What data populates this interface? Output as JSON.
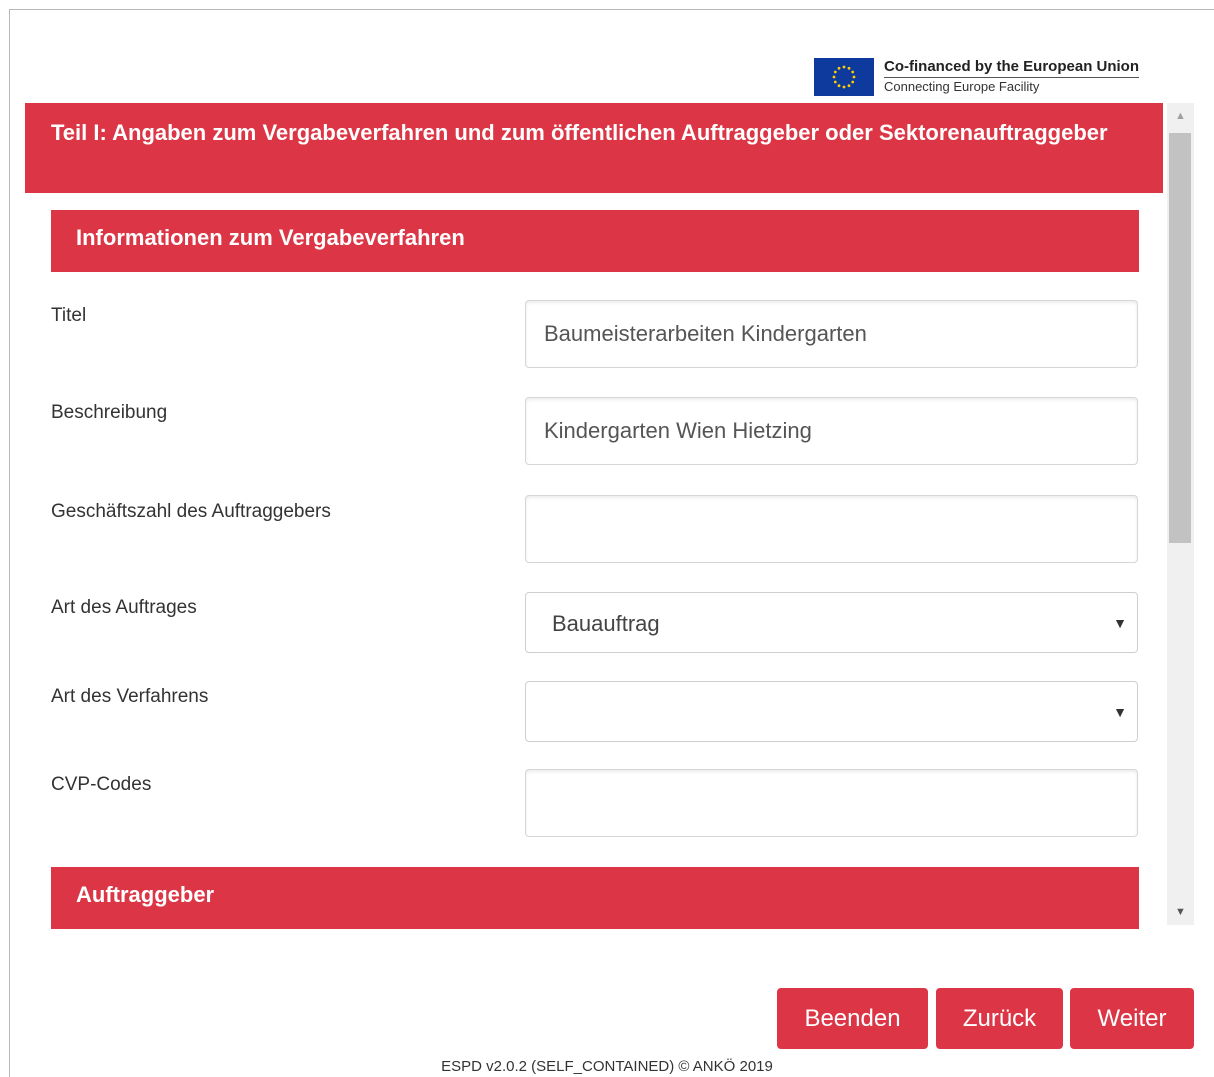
{
  "eu_badge": {
    "line1": "Co-financed by the European Union",
    "line2": "Connecting Europe Facility",
    "flag_color": "#0d3a9c",
    "star_color": "#ffcc00"
  },
  "main_header": "Teil I: Angaben zum Vergabeverfahren und zum öffentlichen Auftraggeber oder Sektorenauftraggeber",
  "sections": {
    "procedure": "Informationen zum Vergabeverfahren",
    "contracting": "Auftraggeber"
  },
  "fields": {
    "titel": {
      "label": "Titel",
      "value": "Baumeisterarbeiten Kindergarten"
    },
    "beschreibung": {
      "label": "Beschreibung",
      "value": "Kindergarten Wien Hietzing"
    },
    "geschaeftszahl": {
      "label": "Geschäftszahl des Auftraggebers",
      "value": ""
    },
    "art_auftrag": {
      "label": "Art des Auftrages",
      "value": "Bauauftrag"
    },
    "art_verfahren": {
      "label": "Art des Verfahrens",
      "value": ""
    },
    "cvp": {
      "label": "CVP-Codes",
      "value": ""
    }
  },
  "buttons": {
    "beenden": "Beenden",
    "zurueck": "Zurück",
    "weiter": "Weiter"
  },
  "footer": "ESPD v2.0.2 (SELF_CONTAINED) © ANKÖ 2019",
  "colors": {
    "accent": "#dc3545"
  }
}
